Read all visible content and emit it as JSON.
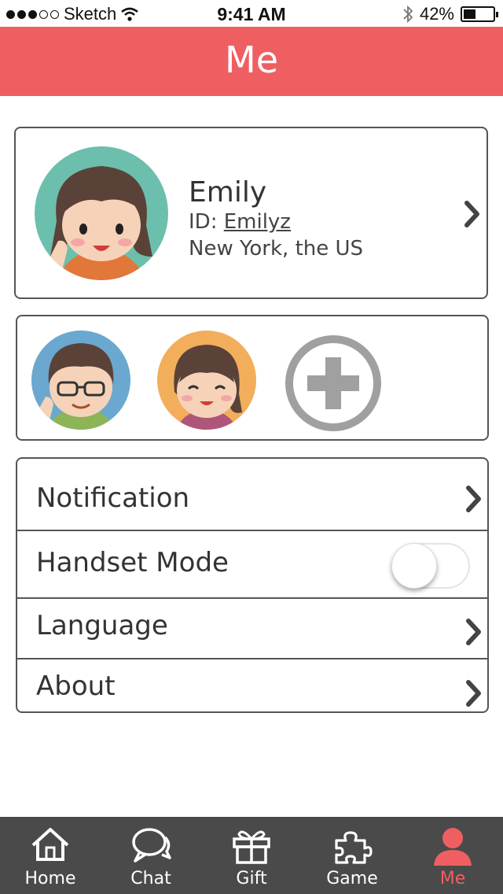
{
  "status_bar": {
    "carrier": "Sketch",
    "time": "9:41 AM",
    "battery": "42%",
    "battery_level": 0.42
  },
  "header": {
    "title": "Me"
  },
  "profile": {
    "name": "Emily",
    "id_label": "ID:",
    "id_value": "Emilyz",
    "location": "New York, the US"
  },
  "family": {
    "members": [
      "grandfather-avatar",
      "grandmother-avatar"
    ],
    "add_icon": "plus-circle-icon"
  },
  "menu": {
    "items": [
      {
        "label": "Notification",
        "control": "chevron"
      },
      {
        "label": "Handset Mode",
        "control": "toggle",
        "on": false
      },
      {
        "label": "Language",
        "control": "chevron"
      },
      {
        "label": "About",
        "control": "chevron"
      }
    ]
  },
  "tabbar": {
    "tabs": [
      {
        "label": "Home",
        "icon": "home-icon"
      },
      {
        "label": "Chat",
        "icon": "chat-icon"
      },
      {
        "label": "Gift",
        "icon": "gift-icon"
      },
      {
        "label": "Game",
        "icon": "puzzle-icon"
      },
      {
        "label": "Me",
        "icon": "person-icon",
        "active": true
      }
    ]
  },
  "colors": {
    "accent": "#ef5f62",
    "tabbar_bg": "#4a4a4a",
    "card_border": "#555555"
  }
}
